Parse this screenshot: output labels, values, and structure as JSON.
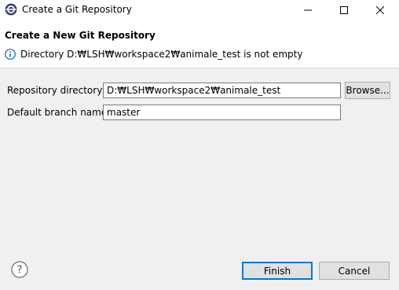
{
  "window": {
    "title": "Create a Git Repository",
    "icon": "eclipse-icon"
  },
  "header": {
    "title": "Create a New Git Repository",
    "message": "Directory D:₩LSH₩workspace2₩animale_test is not empty",
    "message_icon": "info-icon"
  },
  "form": {
    "repository_directory": {
      "label": "Repository directory:",
      "value": "D:₩LSH₩workspace2₩animale_test",
      "browse_label": "Browse..."
    },
    "default_branch": {
      "label": "Default branch name:",
      "value": "master"
    }
  },
  "footer": {
    "help_icon": "help-icon",
    "finish_label": "Finish",
    "cancel_label": "Cancel"
  },
  "colors": {
    "background": "#f0f0f0",
    "header_background": "#ffffff",
    "accent": "#0078d7",
    "info_blue": "#1a5fb4"
  }
}
